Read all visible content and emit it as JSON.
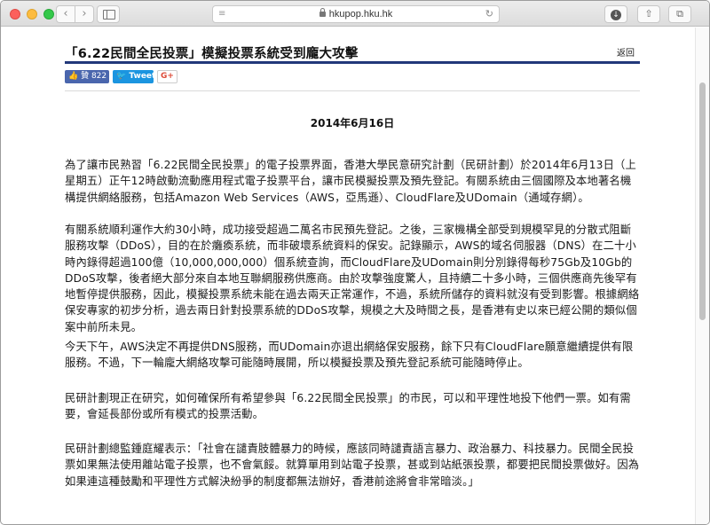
{
  "browser": {
    "url": "hkupop.hku.hk"
  },
  "article": {
    "title": "「6.22民間全民投票」模擬投票系統受到龐大攻擊",
    "back_label": "返回",
    "date": "2014年6月16日",
    "paragraphs": [
      "為了讓市民熟習「6.22民間全民投票」的電子投票界面，香港大學民意研究計劃（民研計劃）於2014年6月13日（上星期五）正午12時啟動流動應用程式電子投票平台，讓市民模擬投票及預先登記。有關系統由三個國際及本地著名機構提供網絡服務，包括Amazon Web Services（AWS，亞馬遜）、CloudFlare及UDomain（通域存網）。",
      "有關系統順利運作大約30小時，成功接受超過二萬名市民預先登記。之後，三家機構全部受到規模罕見的分散式阻斷服務攻擊（DDoS），目的在於癱瘓系統，而非破壞系統資料的保安。記錄顯示，AWS的域名伺服器（DNS）在二十小時內錄得超過100億（10,000,000,000）個系統查詢，而CloudFlare及UDomain則分別錄得每秒75Gb及10Gb的DDoS攻擊，後者絕大部分來自本地互聯網服務供應商。由於攻擊強度驚人，且持續二十多小時，三個供應商先後罕有地暫停提供服務，因此，模擬投票系統未能在過去兩天正常運作，不過，系統所儲存的資料就沒有受到影響。根據網絡保安專家的初步分析，過去兩日針對投票系統的DDoS攻擊，規模之大及時間之長，是香港有史以來已經公開的類似個案中前所未見。",
      "今天下午，AWS決定不再提供DNS服務，而UDomain亦退出網絡保安服務，餘下只有CloudFlare願意繼續提供有限服務。不過，下一輪龐大網絡攻擊可能隨時展開，所以模擬投票及預先登記系統可能隨時停止。",
      "民研計劃現正在研究，如何確保所有希望參與「6.22民間全民投票」的市民，可以和平理性地投下他們一票。如有需要，會延長部份或所有模式的投票活動。",
      "民研計劃總監鍾庭耀表示：「社會在譴責肢體暴力的時候，應該同時譴責語言暴力、政治暴力、科技暴力。民間全民投票如果無法使用離站電子投票，也不會氣餒。就算單用到站電子投票，甚或到站紙張投票，都要把民間投票做好。因為如果連這種鼓勵和平理性方式解決紛爭的制度都無法辦好，香港前途將會非常暗淡。」"
    ]
  },
  "social": {
    "facebook_label": "贊 822",
    "twitter_label": "Tweet",
    "google_label": "G+"
  },
  "colors": {
    "title_rule": "#22387a",
    "facebook": "#4a66ad",
    "twitter": "#1b95e0"
  }
}
